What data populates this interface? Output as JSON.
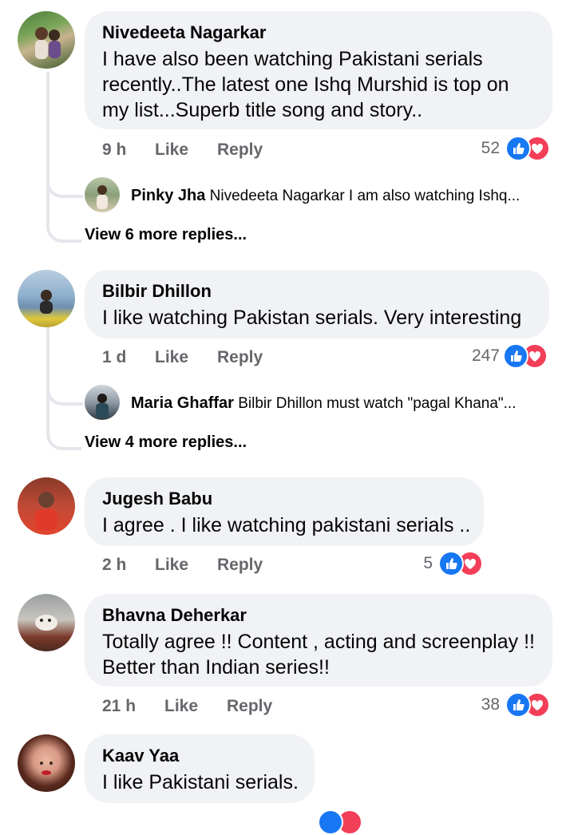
{
  "comments": [
    {
      "name": "Nivedeeta Nagarkar",
      "text_lines": [
        "I have also been watching Pakistani serials",
        "recently..The latest one Ishq Murshid is  top on",
        "my list...Superb title song and story.."
      ],
      "time": "9 h",
      "like": "Like",
      "reply": "Reply",
      "count": "52",
      "reply_preview": {
        "name": "Pinky Jha",
        "text": "Nivedeeta Nagarkar  I am also watching Ishq..."
      },
      "view_more": "View 6 more replies..."
    },
    {
      "name": "Bilbir Dhillon",
      "text_lines": [
        "I like watching Pakistan  serials.  Very interesting"
      ],
      "time": "1 d",
      "like": "Like",
      "reply": "Reply",
      "count": "247",
      "reply_preview": {
        "name": "Maria Ghaffar",
        "text": "Bilbir Dhillon must watch \"pagal Khana\"..."
      },
      "view_more": "View 4 more replies..."
    },
    {
      "name": "Jugesh Babu",
      "text_lines": [
        "I agree . I like watching pakistani serials .."
      ],
      "time": "2 h",
      "like": "Like",
      "reply": "Reply",
      "count": "5"
    },
    {
      "name": "Bhavna Deherkar",
      "text_lines": [
        "Totally agree !! Content , acting and screenplay  !!",
        "Better than Indian series!!"
      ],
      "time": "21 h",
      "like": "Like",
      "reply": "Reply",
      "count": "38"
    },
    {
      "name": "Kaav Yaa",
      "text_lines": [
        "I like Pakistani serials."
      ]
    }
  ],
  "icons": {
    "like_reaction": "thumbs-up-icon",
    "love_reaction": "heart-icon"
  },
  "colors": {
    "like": "#1877f2",
    "love": "#f33e58",
    "bubble": "#f0f2f5",
    "meta": "#65676b"
  }
}
